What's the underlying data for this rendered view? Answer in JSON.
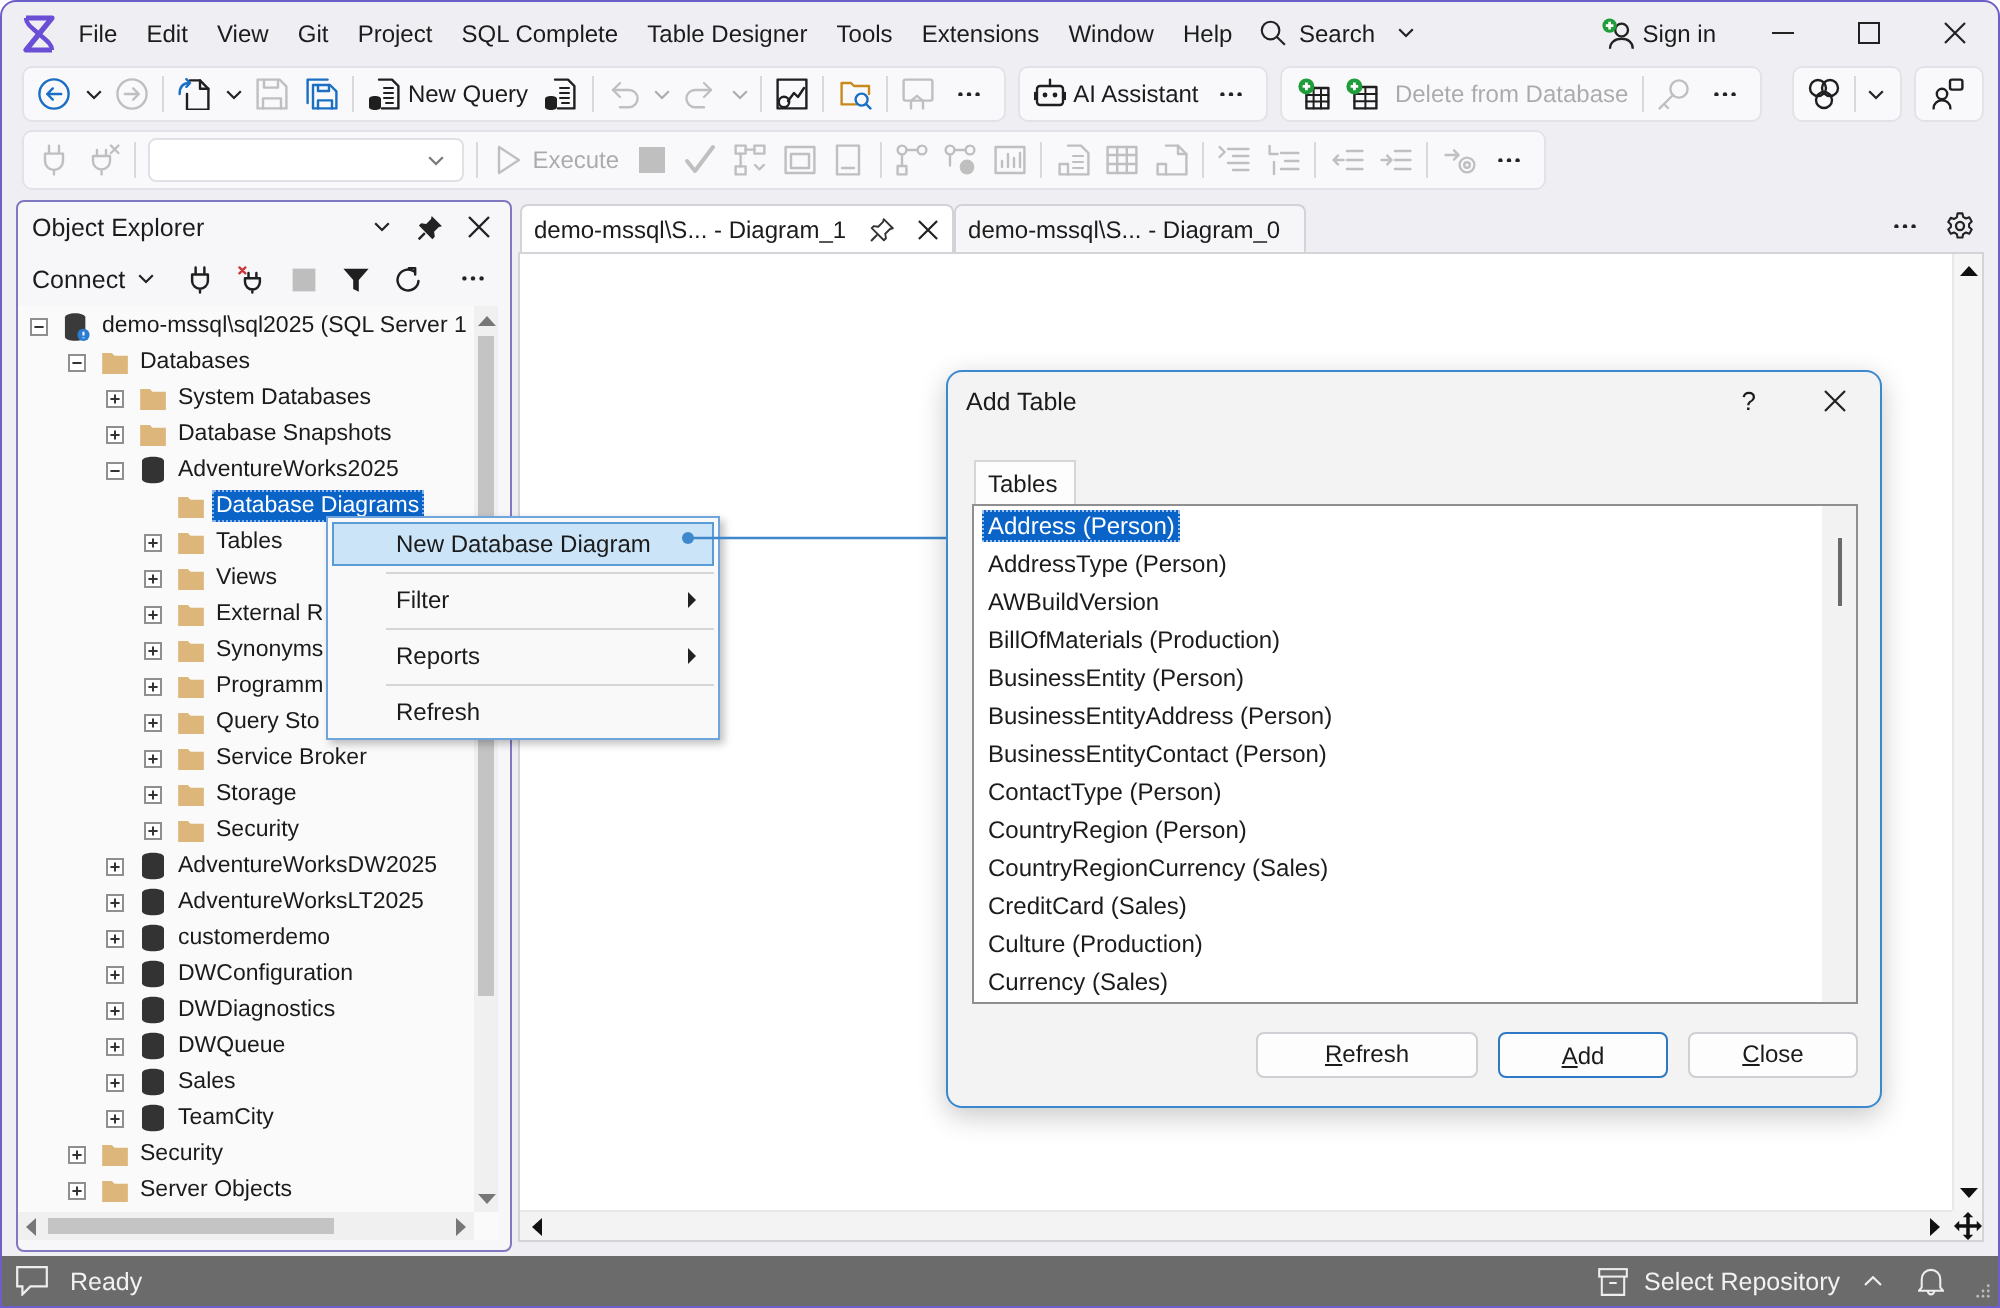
{
  "menu_bar": {
    "items": [
      "File",
      "Edit",
      "View",
      "Git",
      "Project",
      "SQL Complete",
      "Table Designer",
      "Tools",
      "Extensions",
      "Window",
      "Help"
    ],
    "search": {
      "label": "Search"
    },
    "sign_in": {
      "label": "Sign in"
    }
  },
  "toolbar_1": {
    "groups": [
      {
        "sections": [
          [
            {
              "kind": "icon",
              "disabled": false
            },
            {
              "kind": "dropdown",
              "disabled": false
            },
            {
              "kind": "icon",
              "disabled": true
            }
          ],
          [
            {
              "kind": "icon",
              "disabled": false
            },
            {
              "kind": "dropdown",
              "disabled": false
            },
            {
              "kind": "icon",
              "disabled": true
            },
            {
              "kind": "icon",
              "disabled": false
            }
          ],
          [
            {
              "kind": "labeled",
              "label": "New Query",
              "disabled": false
            },
            {
              "kind": "icon",
              "disabled": false
            }
          ],
          [
            {
              "kind": "icon",
              "disabled": true
            },
            {
              "kind": "dropdown",
              "disabled": true
            },
            {
              "kind": "icon",
              "disabled": true
            },
            {
              "kind": "dropdown",
              "disabled": true
            }
          ],
          [
            {
              "kind": "icon",
              "disabled": false
            }
          ],
          [
            {
              "kind": "icon",
              "disabled": false
            }
          ],
          [
            {
              "kind": "icon",
              "disabled": true
            },
            {
              "kind": "more"
            }
          ]
        ]
      },
      {
        "sections": [
          [
            {
              "kind": "labeled",
              "label": "AI Assistant",
              "disabled": false
            },
            {
              "kind": "more"
            }
          ]
        ]
      },
      {
        "sections": [
          [
            {
              "kind": "icon",
              "disabled": false
            },
            {
              "kind": "icon",
              "disabled": false
            },
            {
              "kind": "text",
              "label": "Delete from Database",
              "disabled": true
            }
          ],
          [
            {
              "kind": "icon",
              "disabled": true
            },
            {
              "kind": "more"
            }
          ]
        ]
      }
    ],
    "right_groups": [
      {
        "sections": [
          [
            {
              "kind": "icon",
              "disabled": false
            }
          ],
          [
            {
              "kind": "dropdown",
              "disabled": false
            }
          ]
        ]
      },
      {
        "sections": [
          [
            {
              "kind": "icon",
              "disabled": false
            }
          ]
        ]
      }
    ]
  },
  "toolbar_2": {
    "groups": [
      {
        "sections": [
          [
            {
              "kind": "icon",
              "disabled": true
            },
            {
              "kind": "icon",
              "disabled": true
            }
          ],
          [
            {
              "kind": "combo"
            }
          ],
          [
            {
              "kind": "labeled",
              "label": "Execute",
              "disabled": true
            },
            {
              "kind": "icon",
              "disabled": true
            },
            {
              "kind": "icon",
              "disabled": true
            },
            {
              "kind": "icon",
              "disabled": true
            },
            {
              "kind": "icon",
              "disabled": true
            },
            {
              "kind": "icon",
              "disabled": true
            }
          ],
          [
            {
              "kind": "icon",
              "disabled": true
            },
            {
              "kind": "icon",
              "disabled": true
            },
            {
              "kind": "icon",
              "disabled": true
            }
          ],
          [
            {
              "kind": "icon",
              "disabled": true
            },
            {
              "kind": "icon",
              "disabled": true
            },
            {
              "kind": "icon",
              "disabled": true
            }
          ],
          [
            {
              "kind": "icon",
              "disabled": true
            },
            {
              "kind": "icon",
              "disabled": true
            }
          ],
          [
            {
              "kind": "icon",
              "disabled": true
            },
            {
              "kind": "icon",
              "disabled": true
            }
          ],
          [
            {
              "kind": "icon",
              "disabled": true
            },
            {
              "kind": "more"
            }
          ]
        ]
      }
    ]
  },
  "object_explorer": {
    "title": "Object Explorer",
    "connect": {
      "label": "Connect"
    },
    "tools": [
      {
        "kind": "icon",
        "disabled": false
      },
      {
        "kind": "icon",
        "disabled": false
      },
      {
        "kind": "icon",
        "disabled": true
      },
      {
        "kind": "icon",
        "disabled": false
      },
      {
        "kind": "icon",
        "disabled": false
      },
      {
        "kind": "more"
      }
    ],
    "tree": [
      {
        "label": "demo-mssql\\sql2025 (SQL Server 1",
        "kind": "server",
        "expanded": true,
        "selected": false,
        "children": [
          {
            "label": "Databases",
            "kind": "folder",
            "expanded": true,
            "selected": false,
            "children": [
              {
                "label": "System Databases",
                "kind": "folder",
                "expanded": false,
                "selected": false
              },
              {
                "label": "Database Snapshots",
                "kind": "folder",
                "expanded": false,
                "selected": false
              },
              {
                "label": "AdventureWorks2025",
                "kind": "database",
                "expanded": true,
                "selected": false,
                "children": [
                  {
                    "label": "Database Diagrams",
                    "kind": "folder",
                    "selected": true
                  },
                  {
                    "label": "Tables",
                    "kind": "folder",
                    "expanded": false,
                    "selected": false
                  },
                  {
                    "label": "Views",
                    "kind": "folder",
                    "expanded": false,
                    "selected": false
                  },
                  {
                    "label": "External R",
                    "kind": "folder",
                    "expanded": false,
                    "selected": false
                  },
                  {
                    "label": "Synonyms",
                    "kind": "folder",
                    "expanded": false,
                    "selected": false
                  },
                  {
                    "label": "Programm",
                    "kind": "folder",
                    "expanded": false,
                    "selected": false
                  },
                  {
                    "label": "Query Sto",
                    "kind": "folder",
                    "expanded": false,
                    "selected": false
                  },
                  {
                    "label": "Service Broker",
                    "kind": "folder",
                    "expanded": false,
                    "selected": false
                  },
                  {
                    "label": "Storage",
                    "kind": "folder",
                    "expanded": false,
                    "selected": false
                  },
                  {
                    "label": "Security",
                    "kind": "folder",
                    "expanded": false,
                    "selected": false
                  }
                ]
              },
              {
                "label": "AdventureWorksDW2025",
                "kind": "database",
                "expanded": false,
                "selected": false
              },
              {
                "label": "AdventureWorksLT2025",
                "kind": "database",
                "expanded": false,
                "selected": false
              },
              {
                "label": "customerdemo",
                "kind": "database",
                "expanded": false,
                "selected": false
              },
              {
                "label": "DWConfiguration",
                "kind": "database",
                "expanded": false,
                "selected": false
              },
              {
                "label": "DWDiagnostics",
                "kind": "database",
                "expanded": false,
                "selected": false
              },
              {
                "label": "DWQueue",
                "kind": "database",
                "expanded": false,
                "selected": false
              },
              {
                "label": "Sales",
                "kind": "database",
                "expanded": false,
                "selected": false
              },
              {
                "label": "TeamCity",
                "kind": "database",
                "expanded": false,
                "selected": false
              }
            ]
          },
          {
            "label": "Security",
            "kind": "folder",
            "expanded": false,
            "selected": false
          },
          {
            "label": "Server Objects",
            "kind": "folder",
            "expanded": false,
            "selected": false
          }
        ]
      }
    ]
  },
  "document_tabs": [
    {
      "label": "demo-mssql\\S... - Diagram_1",
      "selected": true
    },
    {
      "label": "demo-mssql\\S... - Diagram_0",
      "selected": false
    }
  ],
  "context_menu": {
    "items": [
      {
        "label": "New Database Diagram",
        "selected": true,
        "submenu": false
      },
      {
        "label": "Filter",
        "selected": false,
        "submenu": true
      },
      {
        "label": "Reports",
        "selected": false,
        "submenu": true
      },
      {
        "label": "Refresh",
        "selected": false,
        "submenu": false
      }
    ]
  },
  "dialog": {
    "title": "Add Table",
    "help": "?",
    "tabs": [
      {
        "label": "Tables",
        "selected": true
      }
    ],
    "items": [
      {
        "label": "Address (Person)",
        "selected": true
      },
      {
        "label": "AddressType (Person)",
        "selected": false
      },
      {
        "label": "AWBuildVersion",
        "selected": false
      },
      {
        "label": "BillOfMaterials (Production)",
        "selected": false
      },
      {
        "label": "BusinessEntity (Person)",
        "selected": false
      },
      {
        "label": "BusinessEntityAddress (Person)",
        "selected": false
      },
      {
        "label": "BusinessEntityContact (Person)",
        "selected": false
      },
      {
        "label": "ContactType (Person)",
        "selected": false
      },
      {
        "label": "CountryRegion (Person)",
        "selected": false
      },
      {
        "label": "CountryRegionCurrency (Sales)",
        "selected": false
      },
      {
        "label": "CreditCard (Sales)",
        "selected": false
      },
      {
        "label": "Culture (Production)",
        "selected": false
      },
      {
        "label": "Currency (Sales)",
        "selected": false
      }
    ],
    "buttons": [
      {
        "label": "Refresh",
        "default": false
      },
      {
        "label": "Add",
        "default": true
      },
      {
        "label": "Close",
        "default": false
      }
    ]
  },
  "status_bar": {
    "message": "Ready",
    "repository": "Select Repository"
  }
}
